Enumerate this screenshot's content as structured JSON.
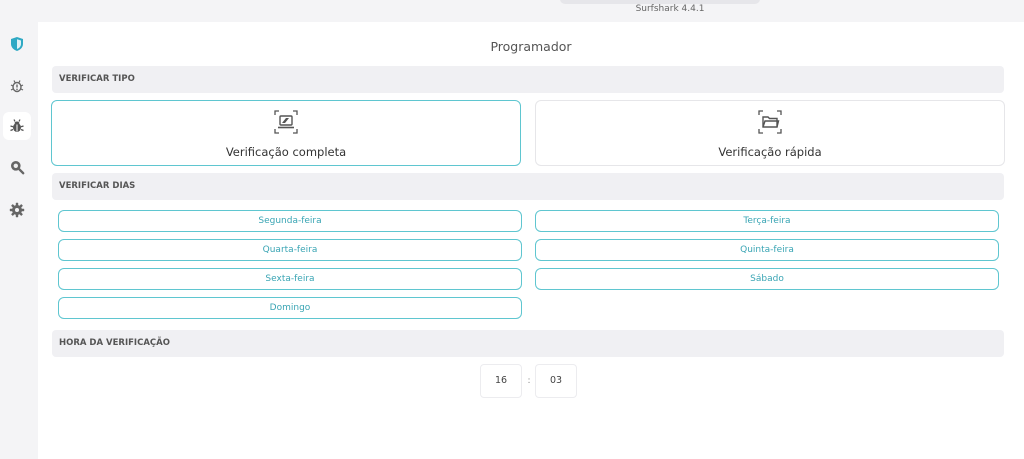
{
  "window": {
    "app_title": "Surfshark 4.4.1"
  },
  "sidebar": {
    "items": [
      {
        "icon": "shield-icon",
        "active": false
      },
      {
        "icon": "alert-bug-icon",
        "active": false
      },
      {
        "icon": "bug-icon",
        "active": true
      },
      {
        "icon": "search-icon",
        "active": false
      },
      {
        "icon": "gear-icon",
        "active": false
      }
    ]
  },
  "page": {
    "title": "Programador"
  },
  "scan_type": {
    "header": "VERIFICAR TIPO",
    "options": [
      {
        "label": "Verificação completa",
        "icon": "laptop-scan-icon",
        "selected": true
      },
      {
        "label": "Verificação rápida",
        "icon": "folder-scan-icon",
        "selected": false
      }
    ]
  },
  "scan_days": {
    "header": "VERIFICAR DIAS",
    "days": [
      "Segunda-feira",
      "Terça-feira",
      "Quarta-feira",
      "Quinta-feira",
      "Sexta-feira",
      "Sábado",
      "Domingo"
    ]
  },
  "scan_time": {
    "header": "HORA DA VERIFICAÇÃO",
    "hour": "16",
    "separator": ":",
    "minute": "03"
  },
  "colors": {
    "accent": "#5fc6d0",
    "accent_text": "#3aa5b4",
    "shield": "#2fa9c4"
  }
}
